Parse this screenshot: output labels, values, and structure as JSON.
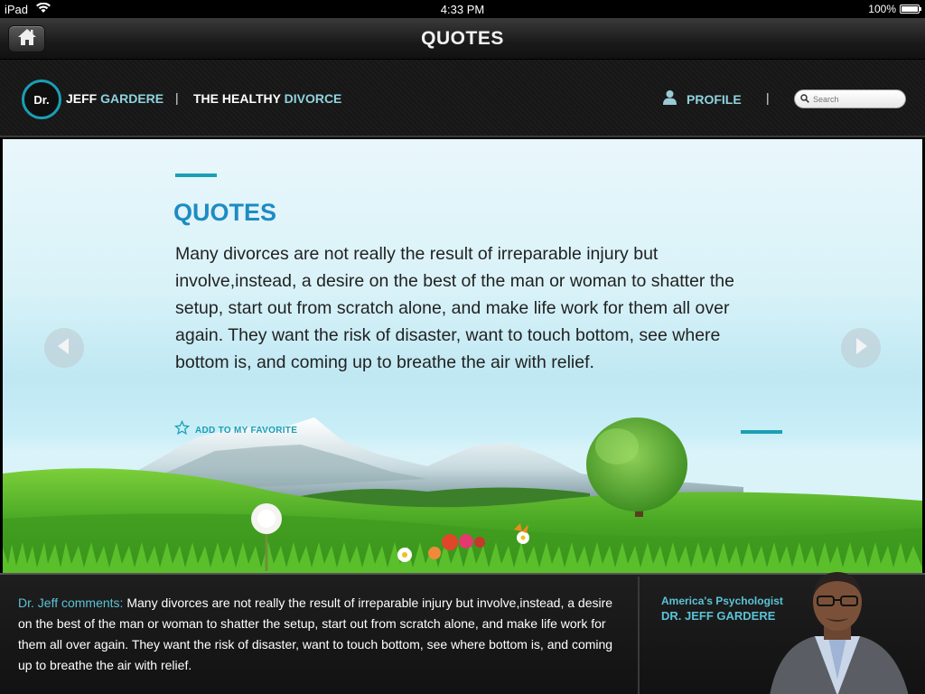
{
  "status_bar": {
    "carrier": "iPad",
    "time": "4:33 PM",
    "battery": "100%",
    "battery_level": 1.0
  },
  "title_bar": {
    "title": "QUOTES",
    "home_icon": "home-icon"
  },
  "nav": {
    "logo_text": "Dr.",
    "brand_first": "JEFF ",
    "brand_accent": "GARDERE",
    "separator": "|",
    "section_first": "THE HEALTHY ",
    "section_accent": "DIVORCE",
    "profile_label": "PROFILE",
    "profile_icon": "person-icon",
    "search_placeholder": "Search",
    "search_icon": "search-icon"
  },
  "hero": {
    "heading": "QUOTES",
    "quote": "Many divorces are not really the result of irreparable injury but involve,instead, a desire on the best of the man or woman to shatter the setup, start out from scratch alone, and make life work for them all over again. They want the risk of disaster, want to touch bottom, see where bottom is, and coming up to breathe the air with relief.",
    "favorite_label": "ADD TO MY FAVORITE",
    "favorite_icon": "star-outline-icon",
    "prev_icon": "chevron-left-icon",
    "next_icon": "chevron-right-icon",
    "accent_color": "#1a9fb5",
    "heading_color": "#1e8bc3"
  },
  "comments": {
    "author_label": "Dr. Jeff comments:",
    "text": " Many divorces are not really the result of irreparable injury but involve,instead, a desire on the best of the man or woman to shatter the setup, start out from scratch alone, and make life work for them all over again. They want the risk of disaster, want to touch bottom, see where bottom is, and coming up to breathe the air with relief."
  },
  "doctor": {
    "tagline": "America's Psychologist",
    "name": "DR. JEFF GARDERE"
  }
}
